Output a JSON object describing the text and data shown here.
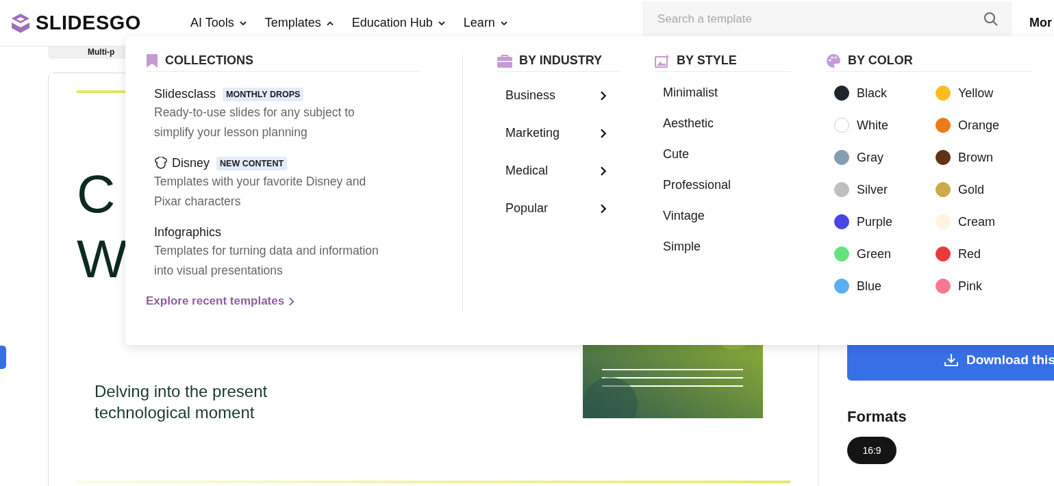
{
  "header": {
    "logo": "SLIDESGO",
    "nav": [
      {
        "label": "AI Tools",
        "expanded": false
      },
      {
        "label": "Templates",
        "expanded": true
      },
      {
        "label": "Education Hub",
        "expanded": false
      },
      {
        "label": "Learn",
        "expanded": false
      }
    ],
    "search": {
      "placeholder": "Search a template"
    },
    "more": "Mor"
  },
  "background": {
    "chip": "Multi-p",
    "slide_letters": [
      "C",
      "W"
    ],
    "slide_subtitle": "Delving into the present technological moment",
    "download_button": "Download this",
    "formats_title": "Formats",
    "format_chip": "16:9"
  },
  "menu": {
    "collections": {
      "title": "COLLECTIONS",
      "items": [
        {
          "kind": "plain",
          "title": "Slidesclass",
          "badge": "MONTHLY DROPS",
          "description": "Ready-to-use slides for any subject to simplify your lesson planning"
        },
        {
          "kind": "mascot",
          "title": "Disney",
          "badge": "NEW CONTENT",
          "description": "Templates with your favorite Disney and Pixar characters"
        },
        {
          "kind": "plain",
          "title": "Infographics",
          "description": "Templates for turning data and information into visual presentations"
        }
      ],
      "explore_link": "Explore recent templates"
    },
    "industry": {
      "title": "BY INDUSTRY",
      "items": [
        "Business",
        "Marketing",
        "Medical",
        "Popular"
      ]
    },
    "style": {
      "title": "BY STYLE",
      "items": [
        "Minimalist",
        "Aesthetic",
        "Cute",
        "Professional",
        "Vintage",
        "Simple"
      ]
    },
    "color": {
      "title": "BY COLOR",
      "items": [
        {
          "label": "Black",
          "color": "#1f252d"
        },
        {
          "label": "Yellow",
          "color": "#fbbd23"
        },
        {
          "label": "White",
          "color": "#ffffff"
        },
        {
          "label": "Orange",
          "color": "#eb7c16"
        },
        {
          "label": "Gray",
          "color": "#849db1"
        },
        {
          "label": "Brown",
          "color": "#5e3318"
        },
        {
          "label": "Silver",
          "color": "#bfbfbf"
        },
        {
          "label": "Gold",
          "color": "#cbab4b"
        },
        {
          "label": "Purple",
          "color": "#4a46e5"
        },
        {
          "label": "Cream",
          "color": "#fdf5df"
        },
        {
          "label": "Green",
          "color": "#63e37f"
        },
        {
          "label": "Red",
          "color": "#ea3a3a"
        },
        {
          "label": "Blue",
          "color": "#5aaef5"
        },
        {
          "label": "Pink",
          "color": "#f87a91"
        }
      ]
    }
  }
}
